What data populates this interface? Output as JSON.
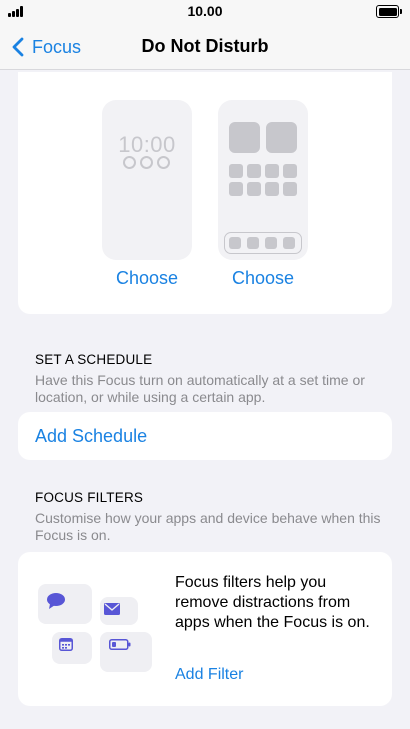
{
  "status_bar": {
    "time": "10.00"
  },
  "nav": {
    "back_label": "Focus",
    "title": "Do Not Disturb"
  },
  "previews": {
    "lock_time": "10:00",
    "lock_choose": "Choose",
    "home_choose": "Choose"
  },
  "schedule": {
    "header": "SET A SCHEDULE",
    "description": "Have this Focus turn on automatically at a set time or location, or while using a certain app.",
    "add_label": "Add Schedule"
  },
  "filters": {
    "header": "FOCUS FILTERS",
    "description": "Customise how your apps and device behave when this Focus is on.",
    "info_text": "Focus filters help you remove distractions from apps when the Focus is on.",
    "add_label": "Add Filter"
  },
  "colors": {
    "accent": "#1a82e2",
    "icon_purple": "#5856d6",
    "background": "#f2f2f7"
  },
  "icons": [
    "signal-icon",
    "battery-icon",
    "chevron-left-icon",
    "message-icon",
    "mail-icon",
    "calendar-icon",
    "battery-tile-icon"
  ]
}
